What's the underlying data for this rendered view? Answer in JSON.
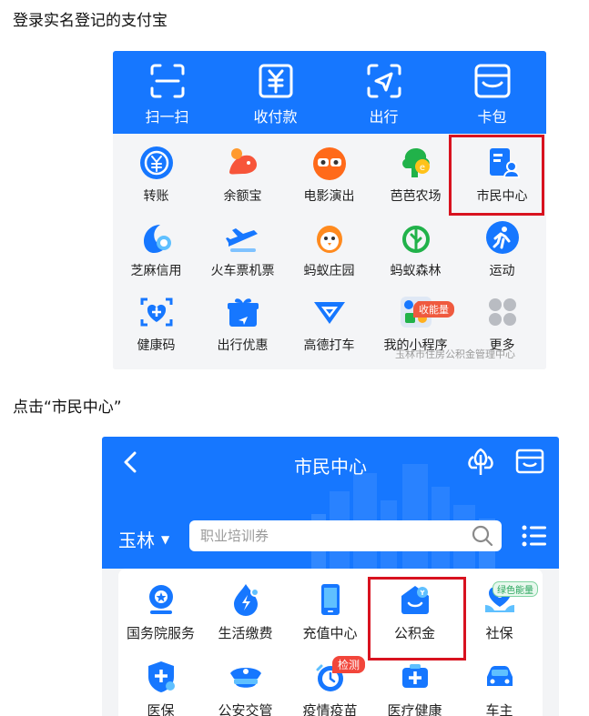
{
  "captions": {
    "step1": "登录实名登记的支付宝",
    "step2": "点击“市民中心”"
  },
  "alipay_home": {
    "top_actions": [
      {
        "label": "扫一扫",
        "icon": "scan-icon"
      },
      {
        "label": "收付款",
        "icon": "yuan-payment-icon"
      },
      {
        "label": "出行",
        "icon": "travel-arrow-icon"
      },
      {
        "label": "卡包",
        "icon": "card-wallet-icon"
      }
    ],
    "apps": [
      {
        "label": "转账",
        "icon": "transfer-icon"
      },
      {
        "label": "余额宝",
        "icon": "yuebao-icon"
      },
      {
        "label": "电影演出",
        "icon": "movie-icon"
      },
      {
        "label": "芭芭农场",
        "icon": "farm-icon"
      },
      {
        "label": "市民中心",
        "icon": "citizen-center-icon"
      },
      {
        "label": "芝麻信用",
        "icon": "sesame-credit-icon"
      },
      {
        "label": "火车票机票",
        "icon": "train-plane-icon"
      },
      {
        "label": "蚂蚁庄园",
        "icon": "chick-icon"
      },
      {
        "label": "蚂蚁森林",
        "icon": "tree-icon"
      },
      {
        "label": "运动",
        "icon": "sport-icon"
      },
      {
        "label": "健康码",
        "icon": "health-code-icon"
      },
      {
        "label": "出行优惠",
        "icon": "travel-discount-icon"
      },
      {
        "label": "高德打车",
        "icon": "gaode-taxi-icon"
      },
      {
        "label": "我的小程序",
        "icon": "mini-program-icon"
      },
      {
        "label": "更多",
        "icon": "more-icon"
      }
    ],
    "energy_badge": "收能量",
    "watermark": "玉林市住房公积金管理中心"
  },
  "citizen_center": {
    "title": "市民中心",
    "city": "玉林",
    "search_placeholder": "职业培训券",
    "services": [
      {
        "label": "国务院服务",
        "icon": "state-council-icon"
      },
      {
        "label": "生活缴费",
        "icon": "utility-pay-icon"
      },
      {
        "label": "充值中心",
        "icon": "recharge-phone-icon"
      },
      {
        "label": "公积金",
        "icon": "housing-fund-icon"
      },
      {
        "label": "社保",
        "icon": "social-security-icon"
      },
      {
        "label": "医保",
        "icon": "medical-insurance-icon"
      },
      {
        "label": "公安交管",
        "icon": "police-hat-icon"
      },
      {
        "label": "疫情疫苗",
        "icon": "vaccine-clock-icon"
      },
      {
        "label": "医疗健康",
        "icon": "medical-health-icon"
      },
      {
        "label": "车主",
        "icon": "car-owner-icon"
      }
    ],
    "green_badge": "绿色能量",
    "test_badge": "检测"
  },
  "colors": {
    "alipay_blue": "#1677ff",
    "highlight_red": "#d8121f",
    "badge_orange": "#ef5a3f",
    "badge_green": "#29a55c"
  }
}
